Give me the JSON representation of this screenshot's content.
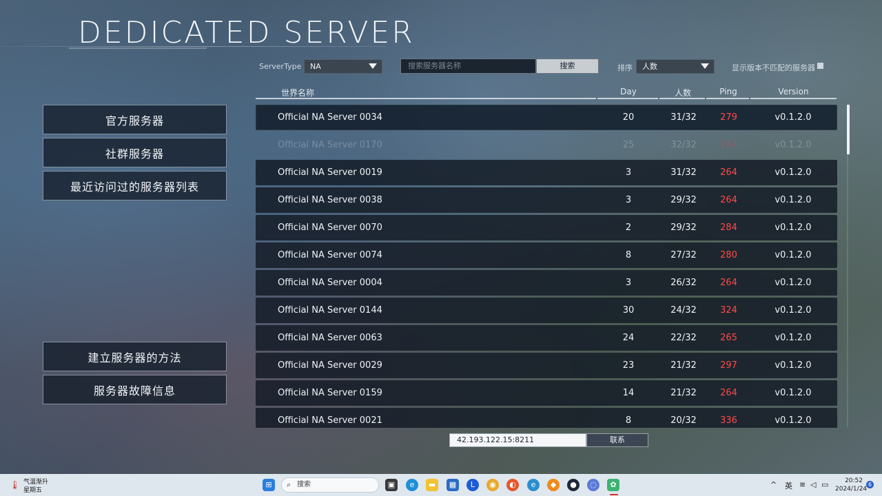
{
  "header": {
    "title": "DEDICATED SERVER"
  },
  "menu": {
    "official": "官方服务器",
    "community": "社群服务器",
    "recent": "最近访问过的服务器列表",
    "howto": "建立服务器的方法",
    "troubleshoot": "服务器故障信息"
  },
  "filters": {
    "server_type_label": "ServerType",
    "server_type_value": "NA",
    "search_placeholder": "搜索服务器名称",
    "search_button": "搜索",
    "sort_label": "排序",
    "sort_value": "人数",
    "mismatch_label": "显示版本不匹配的服务器"
  },
  "table": {
    "headers": {
      "name": "世界名称",
      "day": "Day",
      "players": "人数",
      "ping": "Ping",
      "version": "Version"
    },
    "rows": [
      {
        "name": "Official NA Server 0034",
        "day": "20",
        "players": "31/32",
        "ping": "279",
        "version": "v0.1.2.0"
      },
      {
        "name": "Official NA Server 0170",
        "day": "25",
        "players": "32/32",
        "ping": "264",
        "version": "v0.1.2.0"
      },
      {
        "name": "Official NA Server 0019",
        "day": "3",
        "players": "31/32",
        "ping": "264",
        "version": "v0.1.2.0"
      },
      {
        "name": "Official NA Server 0038",
        "day": "3",
        "players": "29/32",
        "ping": "264",
        "version": "v0.1.2.0"
      },
      {
        "name": "Official NA Server 0070",
        "day": "2",
        "players": "29/32",
        "ping": "284",
        "version": "v0.1.2.0"
      },
      {
        "name": "Official NA Server 0074",
        "day": "8",
        "players": "27/32",
        "ping": "280",
        "version": "v0.1.2.0"
      },
      {
        "name": "Official NA Server 0004",
        "day": "3",
        "players": "26/32",
        "ping": "264",
        "version": "v0.1.2.0"
      },
      {
        "name": "Official NA Server 0144",
        "day": "30",
        "players": "24/32",
        "ping": "324",
        "version": "v0.1.2.0"
      },
      {
        "name": "Official NA Server 0063",
        "day": "24",
        "players": "22/32",
        "ping": "265",
        "version": "v0.1.2.0"
      },
      {
        "name": "Official NA Server 0029",
        "day": "23",
        "players": "21/32",
        "ping": "297",
        "version": "v0.1.2.0"
      },
      {
        "name": "Official NA Server 0159",
        "day": "14",
        "players": "21/32",
        "ping": "264",
        "version": "v0.1.2.0"
      },
      {
        "name": "Official NA Server 0021",
        "day": "8",
        "players": "20/32",
        "ping": "336",
        "version": "v0.1.2.0"
      }
    ]
  },
  "connect": {
    "ip_value": "42.193.122.15:8211",
    "button": "联系"
  },
  "taskbar": {
    "weather_line1": "气温渐升",
    "weather_line2": "星期五",
    "search_label": "搜索",
    "ime": "英",
    "time": "20:52",
    "date": "2024/1/24",
    "notification_count": "6",
    "icons": [
      "windows-start-icon",
      "task-view-icon",
      "edge-icon",
      "file-explorer-icon",
      "store-icon",
      "l-app-icon",
      "chrome-icon",
      "firefox-icon",
      "browser-icon",
      "orange-app-icon",
      "steam-icon",
      "app-icon",
      "game-icon"
    ]
  }
}
